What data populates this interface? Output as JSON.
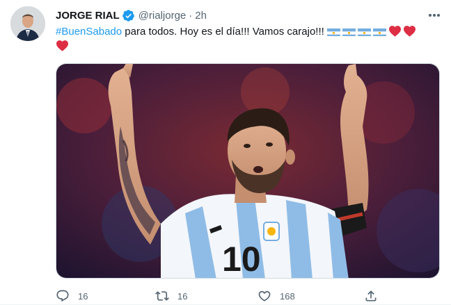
{
  "tweet": {
    "author_name": "JORGE RIAL",
    "author_handle": "@rialjorge",
    "separator": "·",
    "time": "2h",
    "hashtag": "#BuenSabado",
    "text_body": " para todos. Hoy es el día!!! Vamos carajo!!! ",
    "emoji": [
      "flag-argentina",
      "flag-argentina",
      "flag-argentina",
      "flag-argentina",
      "red-heart",
      "red-heart",
      "red-heart"
    ]
  },
  "actions": {
    "reply_count": "16",
    "retweet_count": "16",
    "like_count": "168"
  },
  "icons": {
    "verified": "verified-badge-icon",
    "more": "more-options-icon",
    "reply": "reply-icon",
    "retweet": "retweet-icon",
    "like": "like-icon",
    "share": "share-icon"
  },
  "colors": {
    "accent": "#1d9bf0",
    "secondary_text": "#536471",
    "heart": "#e0245e",
    "flag_blue": "#74acdf"
  }
}
